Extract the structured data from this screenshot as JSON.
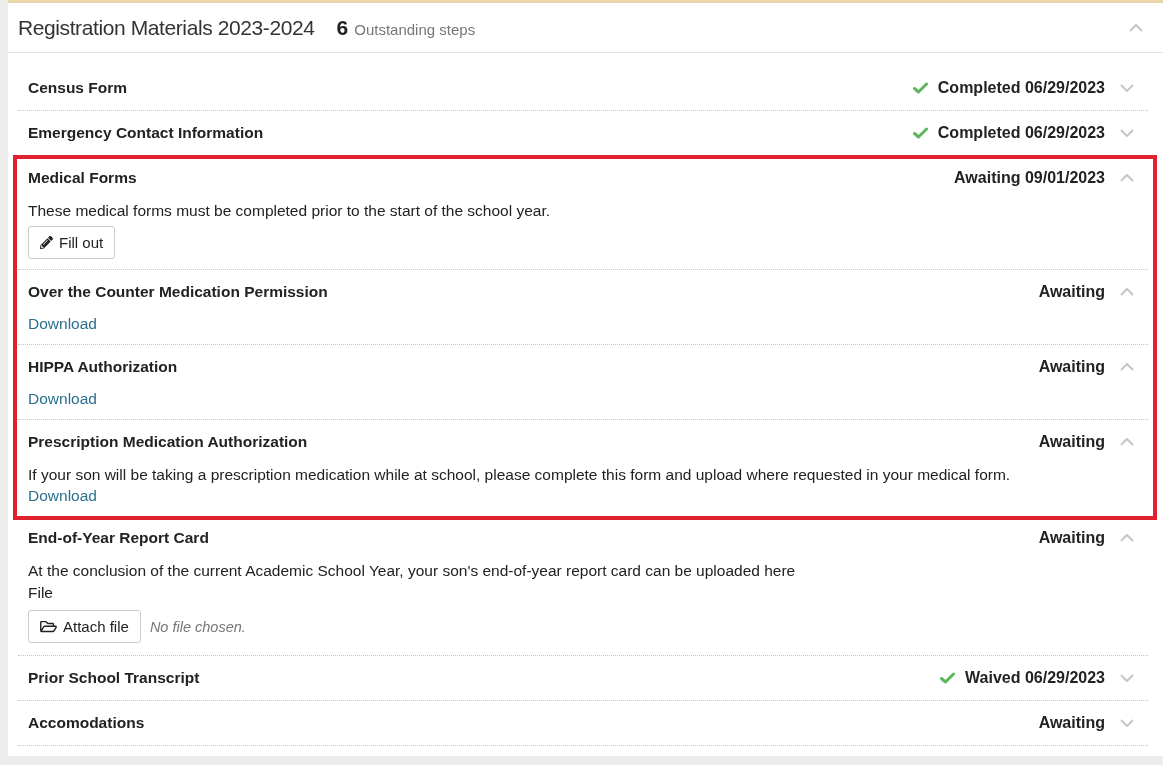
{
  "panel": {
    "title": "Registration Materials 2023-2024",
    "outstanding_count": "6",
    "outstanding_label": "Outstanding steps",
    "expanded": true
  },
  "steps": [
    {
      "title": "Census Form",
      "status": "Completed 06/29/2023",
      "done": true,
      "expanded": false,
      "highlighted": false
    },
    {
      "title": "Emergency Contact Information",
      "status": "Completed 06/29/2023",
      "done": true,
      "expanded": false,
      "highlighted": false
    },
    {
      "title": "Medical Forms",
      "status": "Awaiting 09/01/2023",
      "done": false,
      "expanded": true,
      "highlighted": true,
      "content": [
        {
          "kind": "text",
          "text": "These medical forms must be completed prior to the start of the school year."
        },
        {
          "kind": "button",
          "label": "Fill out"
        }
      ]
    },
    {
      "title": "Over the Counter Medication Permission",
      "status": "Awaiting",
      "done": false,
      "expanded": true,
      "highlighted": true,
      "content": [
        {
          "kind": "link",
          "label": "Download"
        }
      ]
    },
    {
      "title": "HIPPA Authorization",
      "status": "Awaiting",
      "done": false,
      "expanded": true,
      "highlighted": true,
      "content": [
        {
          "kind": "link",
          "label": "Download"
        }
      ]
    },
    {
      "title": "Prescription Medication Authorization",
      "status": "Awaiting",
      "done": false,
      "expanded": true,
      "highlighted": true,
      "content": [
        {
          "kind": "text",
          "text": "If your son will be taking a prescription medication while at school, please complete this form and upload where requested in your medical form."
        },
        {
          "kind": "link",
          "label": "Download"
        }
      ]
    },
    {
      "title": "End-of-Year Report Card",
      "status": "Awaiting",
      "done": false,
      "expanded": true,
      "highlighted": false,
      "content": [
        {
          "kind": "text",
          "text": "At the conclusion of the current Academic School Year, your son's end-of-year report card can be uploaded here"
        },
        {
          "kind": "file",
          "label": "File",
          "button": "Attach file",
          "status": "No file chosen."
        }
      ]
    },
    {
      "title": "Prior School Transcript",
      "status": "Waived 06/29/2023",
      "done": true,
      "expanded": false,
      "highlighted": false
    },
    {
      "title": "Accomodations",
      "status": "Awaiting",
      "done": false,
      "expanded": false,
      "highlighted": false
    }
  ]
}
